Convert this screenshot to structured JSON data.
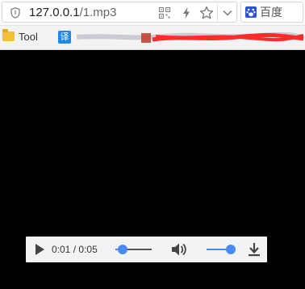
{
  "browser": {
    "url_host": "127.0.0.1",
    "url_path": "/1.mp3",
    "search_engine_label": "百度",
    "icons": [
      "shield-icon",
      "qr-code-icon",
      "lightning-icon",
      "star-icon",
      "chevron-down-icon",
      "baidu-logo-icon"
    ]
  },
  "bookmarks": {
    "folder_label": "Tool",
    "translate_glyph": "译"
  },
  "player": {
    "current_time": "0:01",
    "separator": "/",
    "duration": "0:05",
    "progress_fraction": 0.2,
    "volume_fraction": 1.0,
    "accent_color": "#4a8af4",
    "icons": [
      "play-icon",
      "volume-icon",
      "download-icon"
    ]
  }
}
